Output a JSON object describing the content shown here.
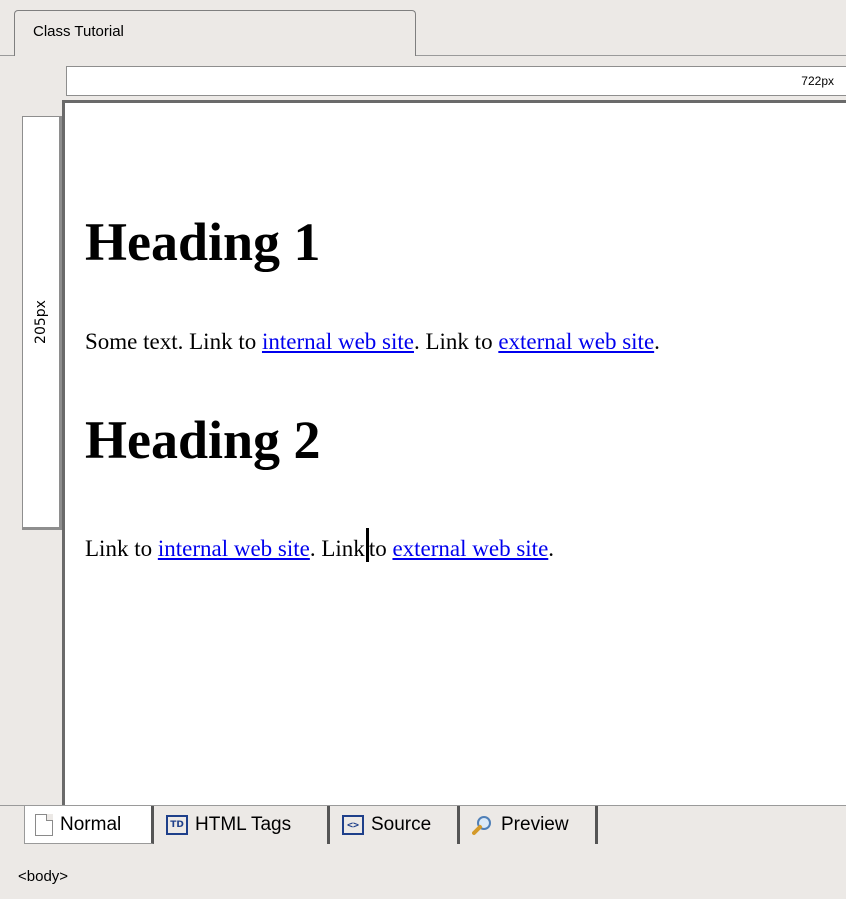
{
  "document_tab": {
    "title": "Class Tutorial"
  },
  "rulers": {
    "width_label": "722px",
    "height_label": "205px"
  },
  "editor": {
    "heading1": "Heading 1",
    "para1": {
      "t1": "Some text. Link to ",
      "link1": "internal web site",
      "t2": ". Link to ",
      "link2": "external web site",
      "t3": "."
    },
    "heading2": "Heading 2",
    "para2": {
      "t1": "Link to ",
      "link1": "internal web site",
      "t2": ". Link",
      "t3": "to ",
      "link2": "external web site",
      "t4": "."
    }
  },
  "view_tabs": [
    {
      "label": "Normal",
      "icon": "page-icon",
      "active": true
    },
    {
      "label": "HTML Tags",
      "icon": "td-icon",
      "active": false
    },
    {
      "label": "Source",
      "icon": "source-code-icon",
      "active": false
    },
    {
      "label": "Preview",
      "icon": "magnifier-icon",
      "active": false
    }
  ],
  "status_bar": {
    "path": "<body>"
  },
  "colors": {
    "link": "#0000ee",
    "chrome": "#ece9e6"
  }
}
